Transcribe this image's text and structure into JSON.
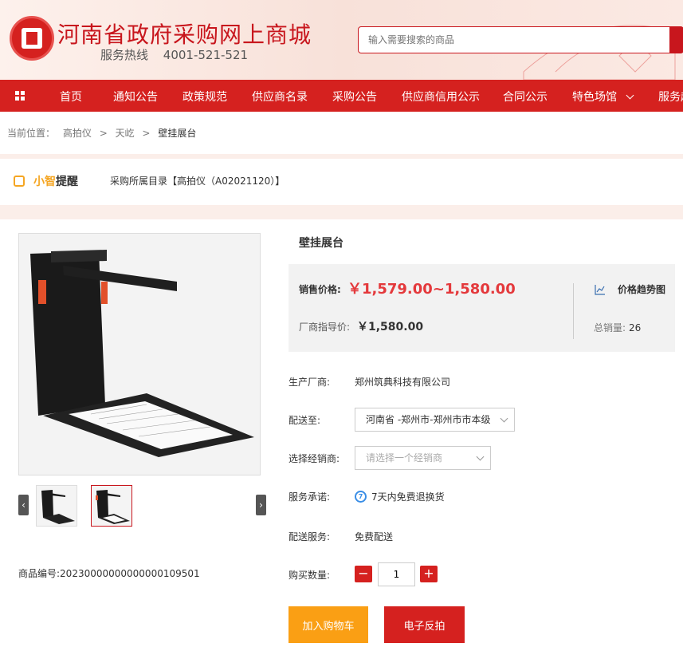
{
  "header": {
    "site_title": "河南省政府采购网上商城",
    "hotline_label": "服务热线",
    "hotline_number": "4001-521-521",
    "search_placeholder": "输入需要搜索的商品"
  },
  "nav": {
    "items": [
      "首页",
      "通知公告",
      "政策规范",
      "供应商名录",
      "采购公告",
      "供应商信用公示",
      "合同公示",
      "特色场馆",
      "服务超"
    ]
  },
  "breadcrumb": {
    "label": "当前位置：",
    "items": [
      "高拍仪",
      "天屹",
      "壁挂展台"
    ],
    "separator": ">"
  },
  "tip": {
    "brand_xz": "小智",
    "brand_tx": "提醒",
    "category_text": "采购所属目录【高拍仪（A02021120）】"
  },
  "product": {
    "name": "壁挂展台",
    "sale_price_label": "销售价格:",
    "sale_price": "￥1,579.00~1,580.00",
    "guide_price_label": "厂商指导价:",
    "guide_price": "￥1,580.00",
    "trend_label": "价格趋势图",
    "sold_label": "总销量:",
    "sold_value": "26",
    "sku_label": "商品编号:",
    "sku": "20230000000000000109501",
    "manufacturer_label": "生产厂商:",
    "manufacturer": "郑州筑典科技有限公司",
    "delivery_to_label": "配送至:",
    "delivery_to": "河南省 -郑州市-郑州市市本级",
    "dealer_label": "选择经销商:",
    "dealer_placeholder": "请选择一个经销商",
    "service_label": "服务承诺:",
    "service_value": "7天内免费退换货",
    "delivery_service_label": "配送服务:",
    "delivery_service": "免费配送",
    "quantity_label": "购买数量:",
    "quantity": "1",
    "add_to_cart": "加入购物车",
    "e_auction": "电子反拍"
  },
  "colors": {
    "brand_red": "#d5211f",
    "price_red": "#e4393c",
    "cart_orange": "#fa9f14"
  },
  "icons": {
    "grid": "grid-icon",
    "robot": "robot-icon",
    "trend": "trend-chart-icon",
    "service": "return-service-icon"
  }
}
